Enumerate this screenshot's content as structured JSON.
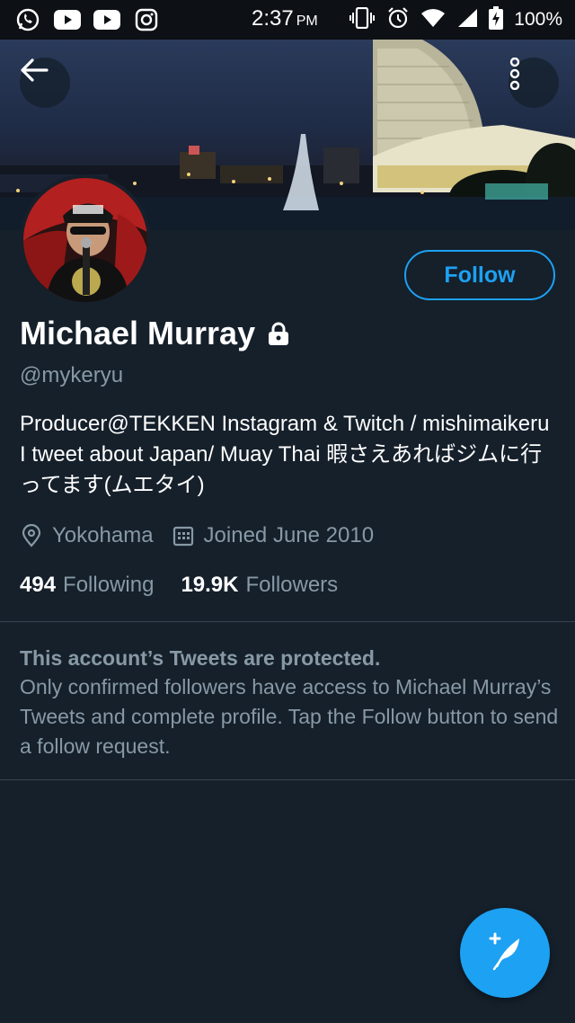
{
  "status_bar": {
    "time": "2:37",
    "ampm": "PM",
    "battery_percent": "100%",
    "icons_left": [
      "whatsapp-icon",
      "youtube-icon",
      "youtube-icon",
      "instagram-icon"
    ],
    "icons_right": [
      "vibrate-icon",
      "alarm-icon",
      "wifi-icon",
      "cell-signal-icon",
      "battery-charging-icon"
    ]
  },
  "profile": {
    "name": "Michael Murray",
    "handle": "@mykeryu",
    "bio": "Producer@TEKKEN Instagram & Twitch / mishimaikeru I tweet about Japan/ Muay Thai 暇さえあればジムに行ってます(ムエタイ)",
    "location": "Yokohama",
    "joined": "Joined June 2010",
    "following_count": "494",
    "following_label": "Following",
    "followers_count": "19.9K",
    "followers_label": "Followers",
    "protected": true
  },
  "actions": {
    "follow_label": "Follow"
  },
  "protected_notice": {
    "title": "This account’s Tweets are protected.",
    "body": "Only confirmed followers have access to Michael Murray’s Tweets and complete profile. Tap the Follow button to send a follow request."
  },
  "colors": {
    "background": "#15202b",
    "accent": "#1da1f2",
    "secondary_text": "#8899a6",
    "divider": "#38444d"
  }
}
